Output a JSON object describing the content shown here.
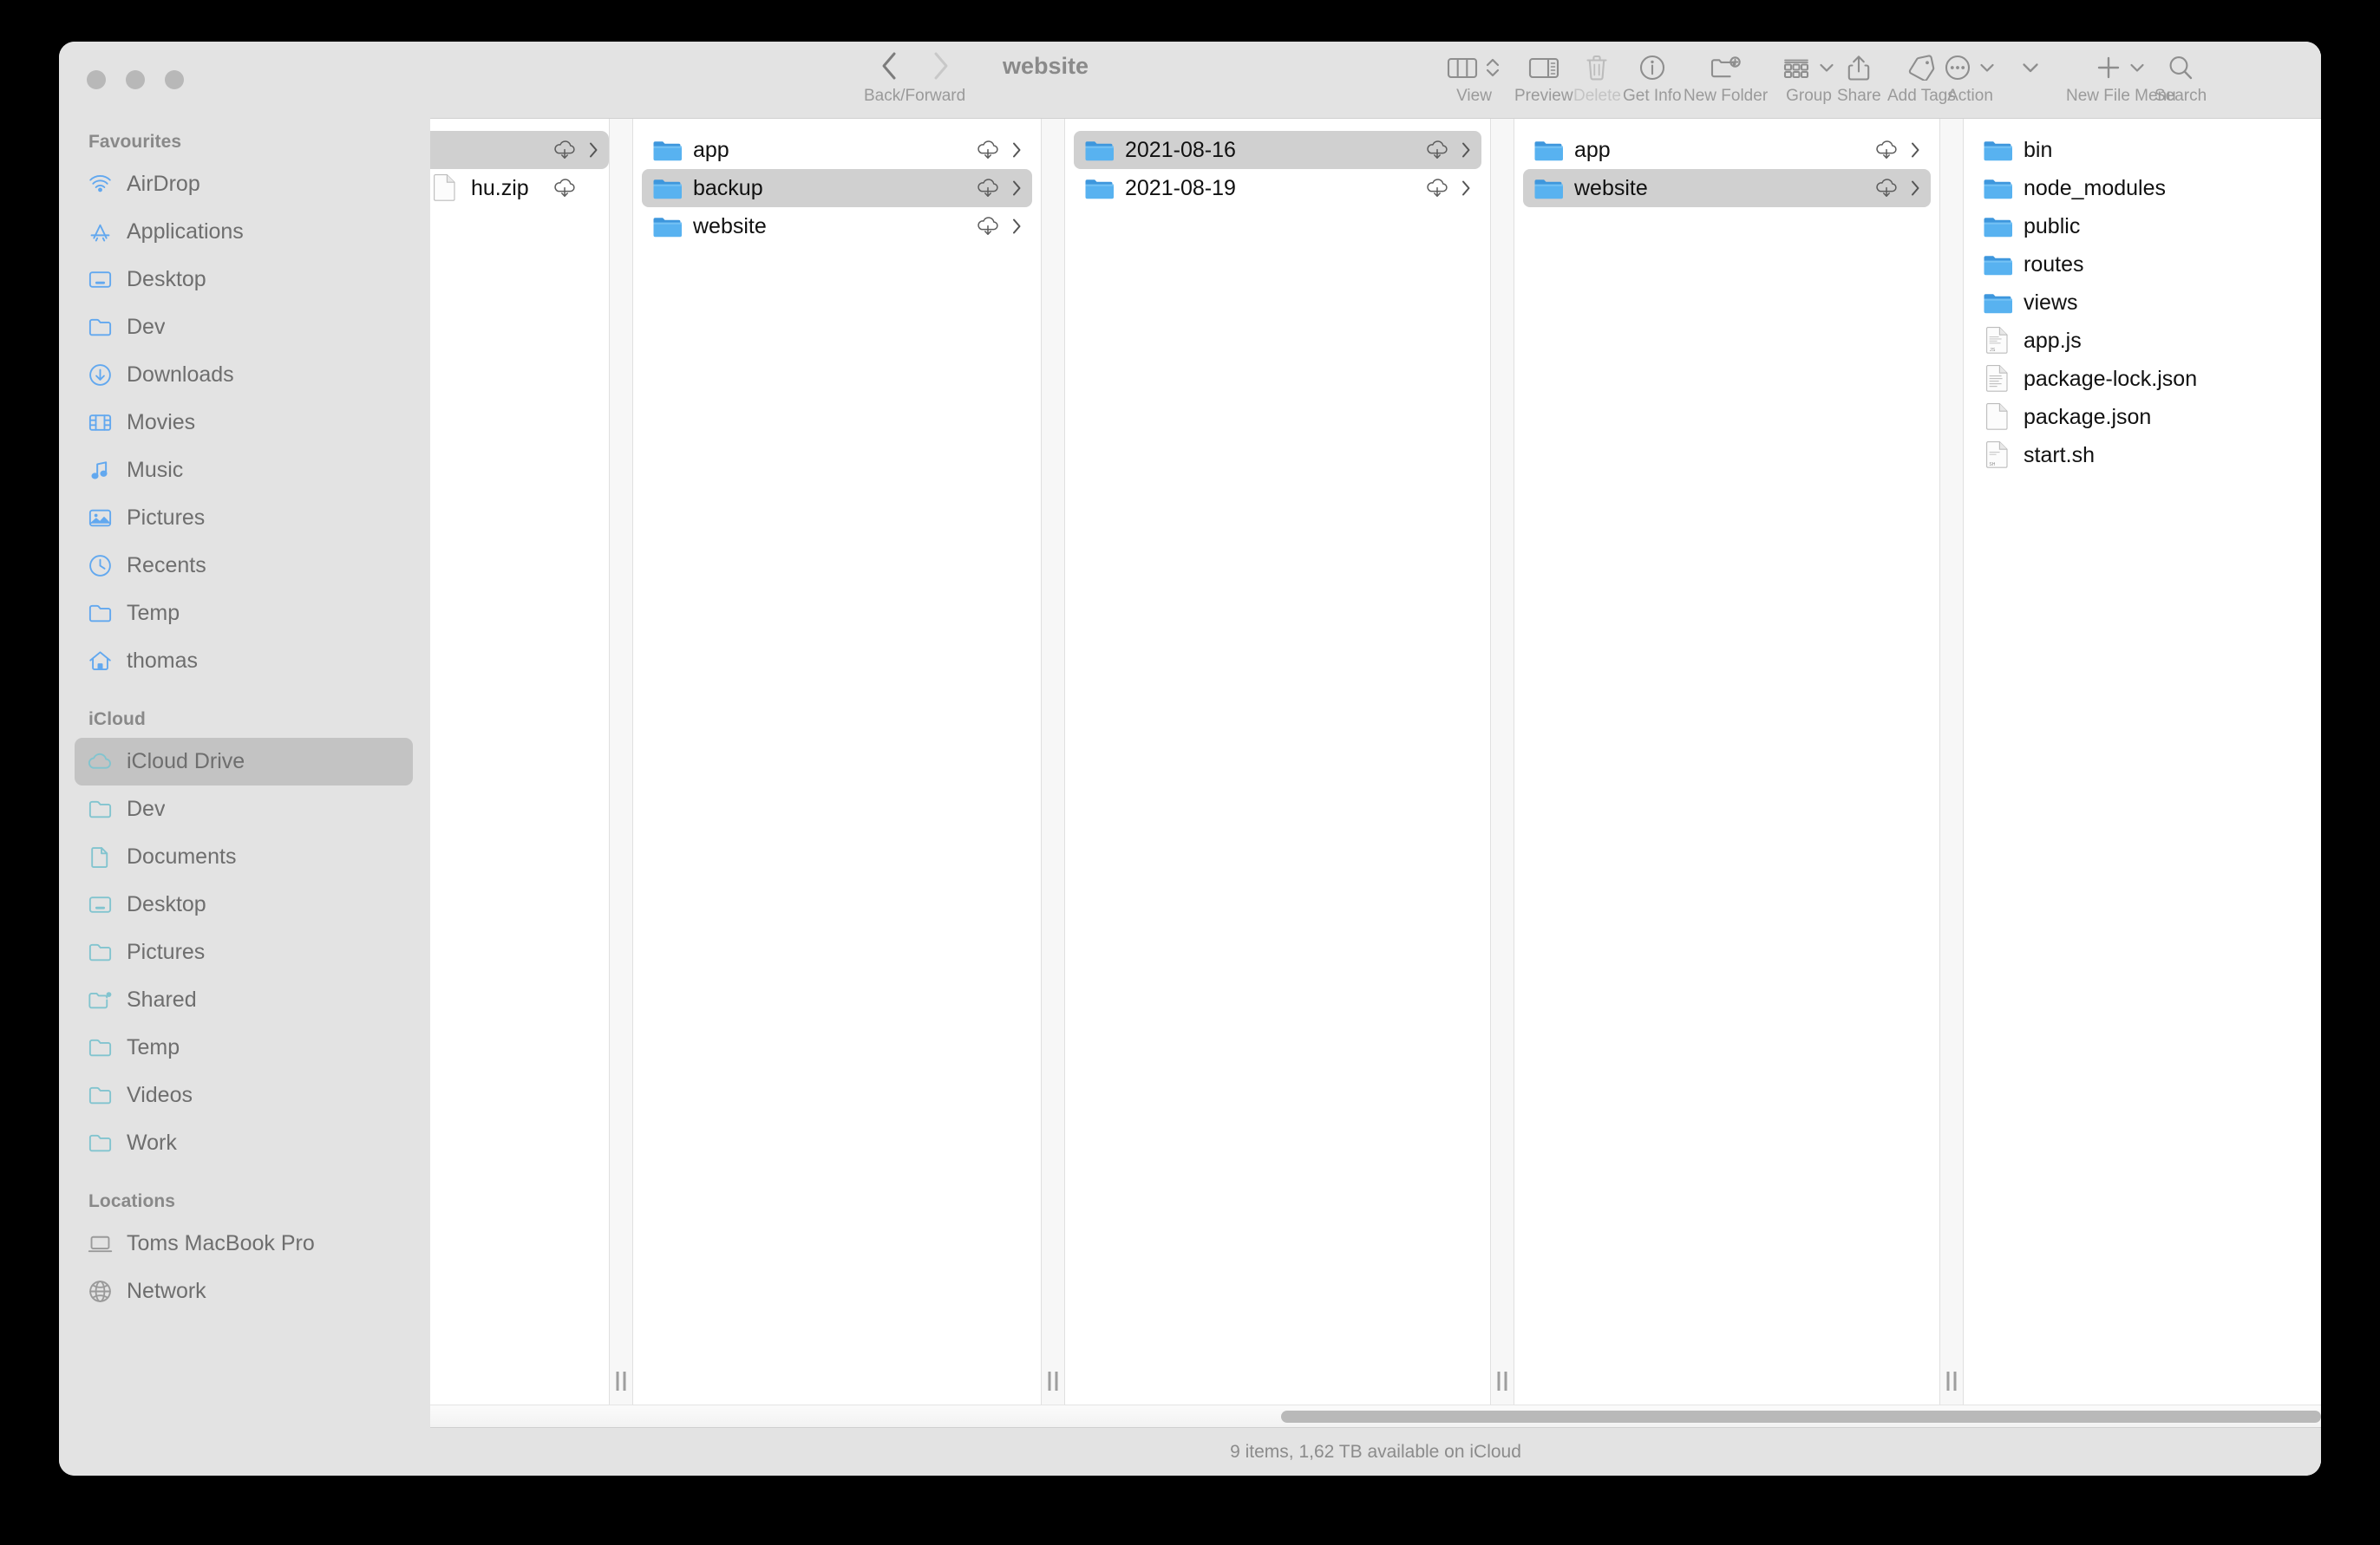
{
  "window": {
    "title": "website",
    "traffic_lights": [
      "close",
      "minimize",
      "zoom"
    ]
  },
  "toolbar": {
    "nav": {
      "back_icon": "chevron-left-icon",
      "forward_icon": "chevron-right-icon",
      "caption": "Back/Forward"
    },
    "items": [
      {
        "id": "view",
        "label": "View",
        "icon": "column-view-icon",
        "has_chevron": true,
        "disabled": false
      },
      {
        "id": "preview",
        "label": "Preview",
        "icon": "preview-pane-icon",
        "has_chevron": false,
        "disabled": false
      },
      {
        "id": "delete",
        "label": "Delete",
        "icon": "trash-icon",
        "has_chevron": false,
        "disabled": true
      },
      {
        "id": "get-info",
        "label": "Get Info",
        "icon": "info-circle-icon",
        "has_chevron": false,
        "disabled": false
      },
      {
        "id": "new-folder",
        "label": "New Folder",
        "icon": "new-folder-icon",
        "has_chevron": false,
        "disabled": false
      },
      {
        "id": "group",
        "label": "Group",
        "icon": "group-icon",
        "has_chevron": true,
        "disabled": false
      },
      {
        "id": "share",
        "label": "Share",
        "icon": "share-icon",
        "has_chevron": false,
        "disabled": false
      },
      {
        "id": "add-tags",
        "label": "Add Tags",
        "icon": "tag-icon",
        "has_chevron": false,
        "disabled": false
      },
      {
        "id": "action",
        "label": "Action",
        "icon": "ellipsis-circle-icon",
        "has_chevron": true,
        "disabled": false
      },
      {
        "id": "overflow",
        "label": "",
        "icon": "chevron-down-icon",
        "has_chevron": false,
        "disabled": false
      },
      {
        "id": "new-file-menu",
        "label": "New File Menu",
        "icon": "plus-icon",
        "has_chevron": true,
        "disabled": false
      },
      {
        "id": "search",
        "label": "Search",
        "icon": "search-icon",
        "has_chevron": false,
        "disabled": false
      }
    ]
  },
  "sidebar": {
    "sections": [
      {
        "title": "Favourites",
        "tint": "#62a8ef",
        "items": [
          {
            "label": "AirDrop",
            "icon": "airdrop-icon",
            "selected": false
          },
          {
            "label": "Applications",
            "icon": "appstore-icon",
            "selected": false
          },
          {
            "label": "Desktop",
            "icon": "desktop-icon",
            "selected": false
          },
          {
            "label": "Dev",
            "icon": "folder-icon",
            "selected": false
          },
          {
            "label": "Downloads",
            "icon": "download-icon",
            "selected": false
          },
          {
            "label": "Movies",
            "icon": "film-icon",
            "selected": false
          },
          {
            "label": "Music",
            "icon": "music-icon",
            "selected": false
          },
          {
            "label": "Pictures",
            "icon": "photo-icon",
            "selected": false
          },
          {
            "label": "Recents",
            "icon": "clock-icon",
            "selected": false
          },
          {
            "label": "Temp",
            "icon": "folder-icon",
            "selected": false
          },
          {
            "label": "thomas",
            "icon": "home-icon",
            "selected": false
          }
        ]
      },
      {
        "title": "iCloud",
        "tint": "#82c4cf",
        "items": [
          {
            "label": "iCloud Drive",
            "icon": "cloud-icon",
            "selected": true
          },
          {
            "label": "Dev",
            "icon": "folder-icon",
            "selected": false
          },
          {
            "label": "Documents",
            "icon": "document-icon",
            "selected": false
          },
          {
            "label": "Desktop",
            "icon": "desktop-icon",
            "selected": false
          },
          {
            "label": "Pictures",
            "icon": "folder-icon",
            "selected": false
          },
          {
            "label": "Shared",
            "icon": "shared-folder-icon",
            "selected": false
          },
          {
            "label": "Temp",
            "icon": "folder-icon",
            "selected": false
          },
          {
            "label": "Videos",
            "icon": "folder-icon",
            "selected": false
          },
          {
            "label": "Work",
            "icon": "folder-icon",
            "selected": false
          }
        ]
      },
      {
        "title": "Locations",
        "tint": "#9a9a9a",
        "items": [
          {
            "label": "Toms MacBook Pro",
            "icon": "laptop-icon",
            "selected": false
          },
          {
            "label": "Network",
            "icon": "globe-icon",
            "selected": false
          }
        ]
      }
    ]
  },
  "columns": [
    {
      "id": "column-1",
      "clipped": true,
      "rows": [
        {
          "name": "",
          "type": "folder",
          "cloud": true,
          "chevron": true,
          "selected": true
        },
        {
          "name": "hu.zip",
          "type": "file",
          "cloud": true,
          "chevron": false,
          "selected": false
        }
      ]
    },
    {
      "id": "column-2",
      "clipped": false,
      "rows": [
        {
          "name": "app",
          "type": "folder",
          "cloud": true,
          "chevron": true,
          "selected": false
        },
        {
          "name": "backup",
          "type": "folder",
          "cloud": true,
          "chevron": true,
          "selected": true
        },
        {
          "name": "website",
          "type": "folder",
          "cloud": true,
          "chevron": true,
          "selected": false
        }
      ]
    },
    {
      "id": "column-3",
      "clipped": false,
      "rows": [
        {
          "name": "2021-08-16",
          "type": "folder",
          "cloud": true,
          "chevron": true,
          "selected": true
        },
        {
          "name": "2021-08-19",
          "type": "folder",
          "cloud": true,
          "chevron": true,
          "selected": false
        }
      ]
    },
    {
      "id": "column-4",
      "clipped": false,
      "rows": [
        {
          "name": "app",
          "type": "folder",
          "cloud": true,
          "chevron": true,
          "selected": false
        },
        {
          "name": "website",
          "type": "folder",
          "cloud": true,
          "chevron": true,
          "selected": true
        }
      ]
    },
    {
      "id": "column-5",
      "clipped": false,
      "rows": [
        {
          "name": "bin",
          "type": "folder",
          "cloud": true,
          "chevron": true,
          "selected": false
        },
        {
          "name": "node_modules",
          "type": "folder",
          "cloud": true,
          "chevron": true,
          "selected": false
        },
        {
          "name": "public",
          "type": "folder",
          "cloud": true,
          "chevron": true,
          "selected": false
        },
        {
          "name": "routes",
          "type": "folder",
          "cloud": true,
          "chevron": true,
          "selected": false
        },
        {
          "name": "views",
          "type": "folder",
          "cloud": true,
          "chevron": true,
          "selected": false
        },
        {
          "name": "app.js",
          "type": "file-js",
          "cloud": false,
          "chevron": false,
          "selected": false
        },
        {
          "name": "package-lock.json",
          "type": "file-text",
          "cloud": false,
          "chevron": false,
          "selected": false
        },
        {
          "name": "package.json",
          "type": "file",
          "cloud": false,
          "chevron": false,
          "selected": false
        },
        {
          "name": "start.sh",
          "type": "file-sh",
          "cloud": false,
          "chevron": false,
          "selected": false
        }
      ]
    }
  ],
  "scrollbar": {
    "orientation": "horizontal",
    "thumb_left_pct": 45,
    "thumb_width_pct": 55
  },
  "status": {
    "text": "9 items, 1,62 TB available on iCloud"
  },
  "colors": {
    "folder_blue": "#4fa3e3",
    "sidebar_bg": "#e3e3e3",
    "selection_gray": "#d0d0d0",
    "sidebar_selection": "#c3c3c3",
    "favourites_tint": "#62a8ef",
    "icloud_tint": "#82c4cf",
    "locations_tint": "#9a9a9a"
  }
}
